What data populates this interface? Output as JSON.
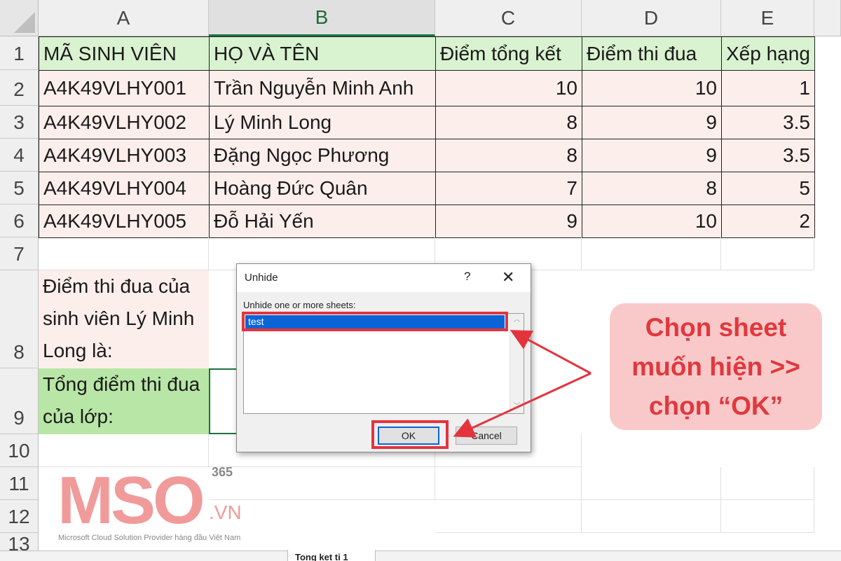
{
  "columns": [
    "A",
    "B",
    "C",
    "D",
    "E"
  ],
  "rows": [
    "1",
    "2",
    "3",
    "4",
    "5",
    "6",
    "7",
    "8",
    "9",
    "10",
    "11",
    "12",
    "13"
  ],
  "header": [
    "MÃ SINH VIÊN",
    "HỌ VÀ TÊN",
    "Điểm tổng kết",
    "Điểm thi đua",
    "Xếp hạng"
  ],
  "data": [
    [
      "A4K49VLHY001",
      "Trần Nguyễn Minh Anh",
      "10",
      "10",
      "1"
    ],
    [
      "A4K49VLHY002",
      "Lý Minh Long",
      "8",
      "9",
      "3.5"
    ],
    [
      "A4K49VLHY003",
      "Đặng Ngọc Phương",
      "8",
      "9",
      "3.5"
    ],
    [
      "A4K49VLHY004",
      "Hoàng Đức Quân",
      "7",
      "8",
      "5"
    ],
    [
      "A4K49VLHY005",
      "Đỗ Hải Yến",
      "9",
      "10",
      "2"
    ]
  ],
  "a8": "Điểm thi đua của sinh viên Lý Minh Long là:",
  "a9": "Tổng điểm thi đua của lớp:",
  "dialog": {
    "title": "Unhide",
    "help": "?",
    "close": "✕",
    "label": "Unhide one or more sheets:",
    "items": [
      "test"
    ],
    "ok": "OK",
    "cancel": "Cancel"
  },
  "callout": "Chọn sheet muốn hiện >> chọn “OK”",
  "logo": {
    "mark": "MSO",
    "superscript": "365",
    "domain": ".VN",
    "tagline": "Microsoft Cloud Solution Provider hàng đầu Việt Nam"
  },
  "sheet_tab": "Tong ket ti 1",
  "colors": {
    "highlight": "#e3343e",
    "header_fill": "#d9f2d0",
    "data_fill": "#fcefeb",
    "selection": "#0a64d6"
  }
}
